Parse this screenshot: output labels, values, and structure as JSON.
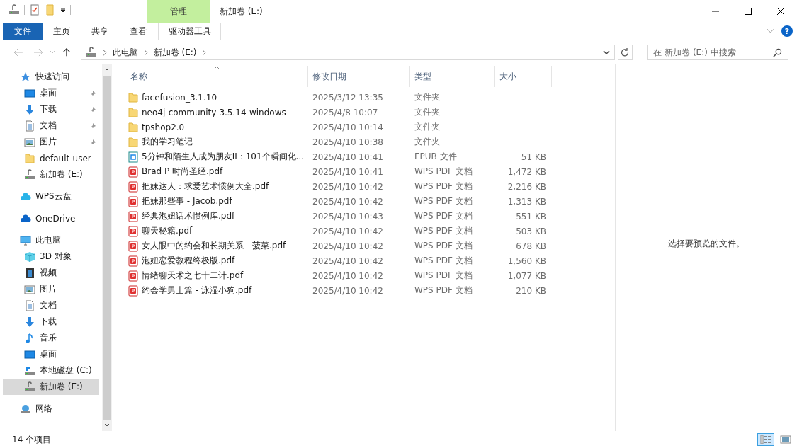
{
  "window": {
    "title": "新加卷 (E:)"
  },
  "ribbon": {
    "context_group": "管理",
    "tabs": [
      {
        "label": "文件",
        "kind": "file"
      },
      {
        "label": "主页",
        "kind": "normal"
      },
      {
        "label": "共享",
        "kind": "normal"
      },
      {
        "label": "查看",
        "kind": "normal"
      },
      {
        "label": "驱动器工具",
        "kind": "context"
      }
    ],
    "help": "?"
  },
  "address": {
    "crumbs": [
      "此电脑",
      "新加卷 (E:)"
    ],
    "search_placeholder": "在 新加卷 (E:) 中搜索"
  },
  "sidebar": {
    "items": [
      {
        "label": "快速访问",
        "kind": "star",
        "selected": false,
        "children": [
          {
            "label": "桌面",
            "kind": "desktop",
            "pinned": true,
            "selected": false
          },
          {
            "label": "下载",
            "kind": "download",
            "pinned": true,
            "selected": false
          },
          {
            "label": "文档",
            "kind": "document",
            "pinned": true,
            "selected": false
          },
          {
            "label": "图片",
            "kind": "picture",
            "pinned": true,
            "selected": false
          },
          {
            "label": "default-user",
            "kind": "folder",
            "pinned": false,
            "selected": false
          },
          {
            "label": "新加卷 (E:)",
            "kind": "drive",
            "pinned": false,
            "selected": false
          }
        ]
      },
      {
        "label": "WPS云盘",
        "kind": "cloud-wps",
        "selected": false
      },
      {
        "label": "OneDrive",
        "kind": "cloud",
        "selected": false
      },
      {
        "label": "此电脑",
        "kind": "pc",
        "selected": false,
        "children": [
          {
            "label": "3D 对象",
            "kind": "cube",
            "pinned": false,
            "selected": false
          },
          {
            "label": "视频",
            "kind": "video",
            "pinned": false,
            "selected": false
          },
          {
            "label": "图片",
            "kind": "picture",
            "pinned": false,
            "selected": false
          },
          {
            "label": "文档",
            "kind": "document",
            "pinned": false,
            "selected": false
          },
          {
            "label": "下载",
            "kind": "download",
            "pinned": false,
            "selected": false
          },
          {
            "label": "音乐",
            "kind": "music",
            "pinned": false,
            "selected": false
          },
          {
            "label": "桌面",
            "kind": "desktop",
            "pinned": false,
            "selected": false
          },
          {
            "label": "本地磁盘 (C:)",
            "kind": "disk",
            "pinned": false,
            "selected": false
          },
          {
            "label": "新加卷 (E:)",
            "kind": "drive",
            "pinned": false,
            "selected": true
          }
        ]
      },
      {
        "label": "网络",
        "kind": "network",
        "selected": false
      }
    ]
  },
  "table": {
    "columns": [
      {
        "label": "名称",
        "sorted": true
      },
      {
        "label": "修改日期",
        "sorted": false
      },
      {
        "label": "类型",
        "sorted": false
      },
      {
        "label": "大小",
        "sorted": false
      }
    ],
    "rows": [
      {
        "kind": "folder",
        "name": "facefusion_3.1.10",
        "date": "2025/3/12 13:35",
        "type": "文件夹",
        "size": ""
      },
      {
        "kind": "folder",
        "name": "neo4j-community-3.5.14-windows",
        "date": "2025/4/8 10:07",
        "type": "文件夹",
        "size": ""
      },
      {
        "kind": "folder",
        "name": "tpshop2.0",
        "date": "2025/4/10 10:14",
        "type": "文件夹",
        "size": ""
      },
      {
        "kind": "folder",
        "name": "我的学习笔记",
        "date": "2025/4/10 10:38",
        "type": "文件夹",
        "size": ""
      },
      {
        "kind": "epub",
        "name": "5分钟和陌生人成为朋友II：101个瞬间化...",
        "date": "2025/4/10 10:41",
        "type": "EPUB 文件",
        "size": "51 KB"
      },
      {
        "kind": "pdf",
        "name": "Brad P 时尚圣经.pdf",
        "date": "2025/4/10 10:41",
        "type": "WPS PDF 文档",
        "size": "1,472 KB"
      },
      {
        "kind": "pdf",
        "name": "把妹达人：求爱艺术惯例大全.pdf",
        "date": "2025/4/10 10:42",
        "type": "WPS PDF 文档",
        "size": "2,216 KB"
      },
      {
        "kind": "pdf",
        "name": "把妹那些事 - Jacob.pdf",
        "date": "2025/4/10 10:42",
        "type": "WPS PDF 文档",
        "size": "1,313 KB"
      },
      {
        "kind": "pdf",
        "name": "经典泡妞话术惯例库.pdf",
        "date": "2025/4/10 10:43",
        "type": "WPS PDF 文档",
        "size": "551 KB"
      },
      {
        "kind": "pdf",
        "name": "聊天秘籍.pdf",
        "date": "2025/4/10 10:42",
        "type": "WPS PDF 文档",
        "size": "503 KB"
      },
      {
        "kind": "pdf",
        "name": "女人眼中的约会和长期关系 - 菠菜.pdf",
        "date": "2025/4/10 10:42",
        "type": "WPS PDF 文档",
        "size": "678 KB"
      },
      {
        "kind": "pdf",
        "name": "泡妞恋爱教程终极版.pdf",
        "date": "2025/4/10 10:42",
        "type": "WPS PDF 文档",
        "size": "1,560 KB"
      },
      {
        "kind": "pdf",
        "name": "情绪聊天术之七十二计.pdf",
        "date": "2025/4/10 10:42",
        "type": "WPS PDF 文档",
        "size": "1,077 KB"
      },
      {
        "kind": "pdf",
        "name": "约会学男士篇 - 泳湿小狗.pdf",
        "date": "2025/4/10 10:42",
        "type": "WPS PDF 文档",
        "size": "210 KB"
      }
    ]
  },
  "preview": {
    "message": "选择要预览的文件。"
  },
  "status_bar": {
    "count": "14 个项目",
    "views": [
      {
        "kind": "details",
        "selected": true
      },
      {
        "kind": "preview",
        "selected": false
      }
    ]
  }
}
